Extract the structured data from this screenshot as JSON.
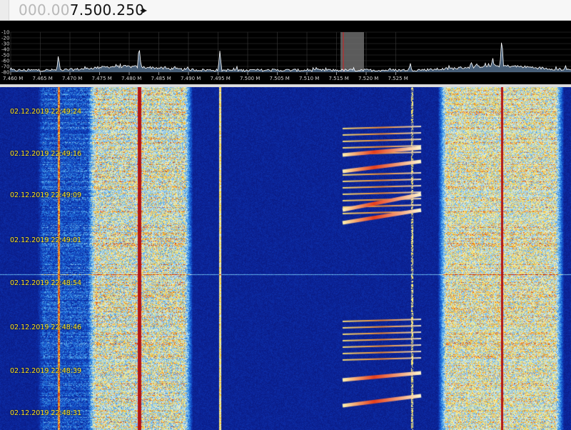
{
  "frequency": {
    "dim_part": "000.00",
    "bright_part": "7.500.250",
    "stepper_glyph": "◂▸"
  },
  "spectrum": {
    "db_labels": [
      "-10",
      "-20",
      "-30",
      "-40",
      "-50",
      "-60",
      "-70",
      "-80"
    ],
    "freq_labels": [
      "7.460 M",
      "7.465 M",
      "7.470 M",
      "7.475 M",
      "7.480 M",
      "7.485 M",
      "7.490 M",
      "7.495 M",
      "7.500 M",
      "7.505 M",
      "7.510 M",
      "7.515 M",
      "7.520 M",
      "7.525 M"
    ],
    "trace_color": "#ffffff",
    "fill_color": "#6b8fb5",
    "tuned_marker_color": "#d22020",
    "passband_color": "#7a7a7a"
  },
  "waterfall": {
    "timestamps": [
      "02.12.2019 22:49:24",
      "02.12.2019 22:49:16",
      "02.12.2019 22:49:09",
      "02.12.2019 22:49:01",
      "02.12.2019 22:48:54",
      "02.12.2019 22:48:46",
      "02.12.2019 22:48:39",
      "02.12.2019 22:48:31"
    ],
    "timestamp_color": "#ffe21a",
    "background_color": "#08106e"
  }
}
